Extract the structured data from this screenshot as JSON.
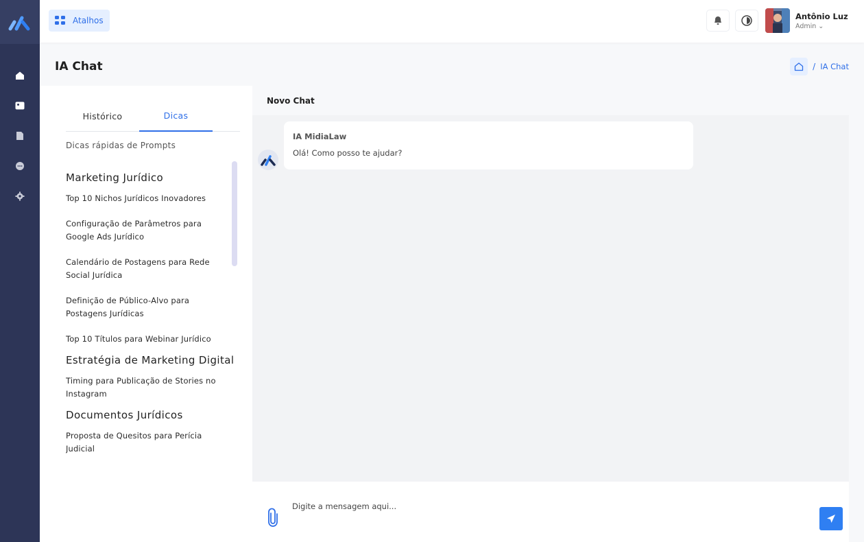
{
  "header": {
    "shortcuts_label": "Atalhos",
    "user_name": "Antônio Luz",
    "user_role": "Admin ⌄"
  },
  "page": {
    "title": "IA Chat",
    "breadcrumb_sep": "/",
    "breadcrumb_current": "IA Chat"
  },
  "left_panel": {
    "tabs": [
      {
        "label": "Histórico",
        "active": false
      },
      {
        "label": "Dicas",
        "active": true
      }
    ],
    "subtitle": "Dicas rápidas de Prompts",
    "categories": [
      {
        "name": "Marketing Jurídico",
        "tips": [
          "Top 10 Nichos Jurídicos Inovadores",
          "Configuração de Parâmetros para Google Ads Jurídico",
          "Calendário de Postagens para Rede Social Jurídica",
          "Definição de Público-Alvo para Postagens Jurídicas",
          "Top 10 Títulos para Webinar Jurídico"
        ]
      },
      {
        "name": "Estratégia de Marketing Digital",
        "tips": [
          "Timing para Publicação de Stories no Instagram"
        ]
      },
      {
        "name": "Documentos Jurídicos",
        "tips": [
          "Proposta de Quesitos para Perícia Judicial"
        ]
      }
    ]
  },
  "chat": {
    "title": "Novo Chat",
    "messages": [
      {
        "sender": "IA MidiaLaw",
        "text": "Olá! Como posso te ajudar?"
      }
    ],
    "input_placeholder": "Digite a mensagem aqui..."
  },
  "colors": {
    "sidebar": "#2d3557",
    "accent": "#2f6fe8",
    "send_button": "#2f7ff2"
  },
  "icons": {
    "sidebar": [
      "home-icon",
      "image-icon",
      "document-icon",
      "chat-icon",
      "settings-icon"
    ],
    "topbar": [
      "grid-icon",
      "bell-icon",
      "theme-toggle-icon"
    ],
    "chat": [
      "paperclip-icon",
      "send-icon"
    ]
  }
}
